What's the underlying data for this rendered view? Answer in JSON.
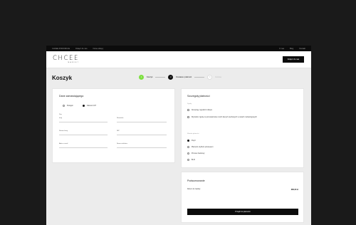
{
  "topbar": {
    "left": [
      "CHCEE PODIUMUJE",
      "Dołącz do nas",
      "Nowe sklepy"
    ],
    "right": [
      "O nas",
      "Blog",
      "Kontakt"
    ]
  },
  "header": {
    "logo_main": "CHCEE",
    "logo_sub": "MARKET",
    "button": "Dołącz do nas"
  },
  "page": {
    "title": "Koszyk"
  },
  "steps": [
    {
      "number": "1",
      "label": "Koszyk"
    },
    {
      "number": "2",
      "label": "Dostawa i płatność"
    },
    {
      "number": "3",
      "label": "Gotowe"
    }
  ],
  "orderer": {
    "title": "Dane zamawiającego",
    "options": [
      "Paragon",
      "Faktura VAT"
    ],
    "selected": "Faktura VAT",
    "fields": {
      "prefix": "Pan",
      "first_name": "Imię",
      "last_name": "Nazwisko",
      "company": "Nazwa firmy",
      "nip": "NIP",
      "email": "Adres e-mail",
      "phone": "Numer telefonu"
    }
  },
  "payment_details": {
    "title": "Szczegóły płatności",
    "consents_label": "Zgody",
    "consents": [
      "Akceptuję regulamin sklepu",
      "Wyrażam zgodę na przetwarzanie moich danych osobowych w celach marketingowych"
    ],
    "methods_label": "Metoda płatności",
    "methods": [
      "PayU",
      "Płatność szybkim przelewem",
      "Przelew bankowy",
      "BLIK"
    ],
    "selected_method": "PayU"
  },
  "summary": {
    "title": "Podsumowanie",
    "row_label": "Razem do zapłaty",
    "row_value": "380,00 zł",
    "pay_button": "Przejdź do płatności"
  },
  "colors": {
    "accent_green": "#7ee042",
    "dark": "#0c0c0c",
    "page_bg": "#1a1a1a",
    "content_bg": "#ececec"
  }
}
